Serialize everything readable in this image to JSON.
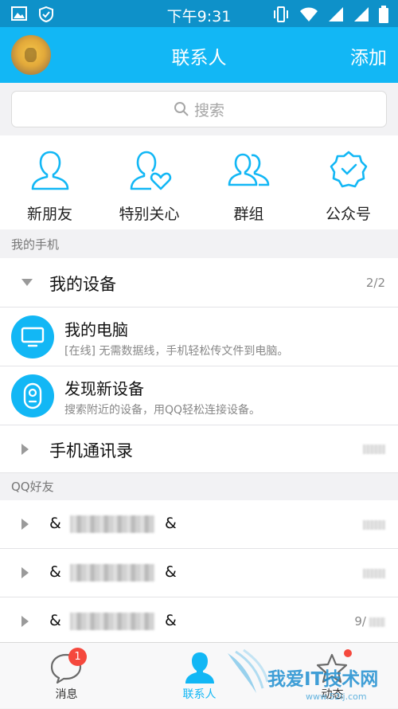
{
  "status_bar": {
    "time": "下午9:31"
  },
  "header": {
    "title": "联系人",
    "add_label": "添加"
  },
  "search": {
    "placeholder": "搜索"
  },
  "quick_entries": [
    {
      "label": "新朋友",
      "icon": "new-friend-icon"
    },
    {
      "label": "特别关心",
      "icon": "special-care-icon"
    },
    {
      "label": "群组",
      "icon": "group-icon"
    },
    {
      "label": "公众号",
      "icon": "official-account-icon"
    }
  ],
  "sections": {
    "my_phone": "我的手机",
    "qq_friends": "QQ好友"
  },
  "my_devices": {
    "label": "我的设备",
    "count": "2/2"
  },
  "devices": [
    {
      "title": "我的电脑",
      "subtitle": "[在线] 无需数据线，手机轻松传文件到电脑。"
    },
    {
      "title": "发现新设备",
      "subtitle": "搜索附近的设备，用QQ轻松连接设备。"
    }
  ],
  "contacts_group": {
    "label": "手机通讯录"
  },
  "friend_groups": [
    {
      "prefix": "&",
      "suffix": "&",
      "count": ""
    },
    {
      "prefix": "&",
      "suffix": "&",
      "count": ""
    },
    {
      "prefix": "&",
      "suffix": "&",
      "count": "9/"
    }
  ],
  "tabs": [
    {
      "label": "消息",
      "badge": "1"
    },
    {
      "label": "联系人"
    },
    {
      "label": "动态"
    }
  ],
  "watermark": {
    "text": "我爱IT技术网",
    "url": "www.52ij.com"
  },
  "colors": {
    "header": "#12b7f5",
    "status_bar": "#0e91c9",
    "accent": "#12b7f5",
    "badge": "#f5483d"
  }
}
